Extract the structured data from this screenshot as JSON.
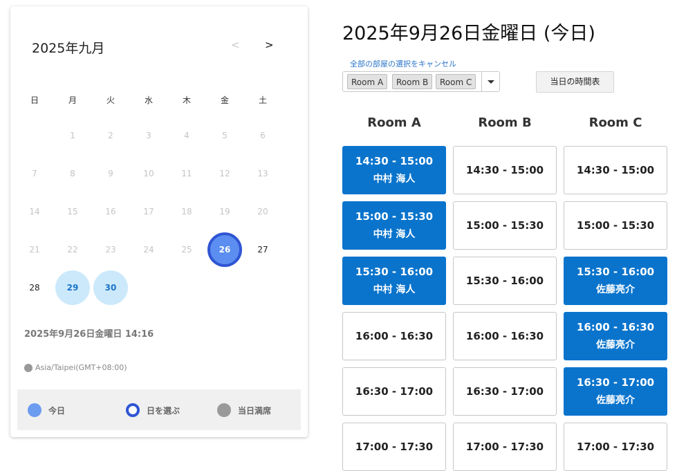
{
  "calendar": {
    "month_title": "2025年九月",
    "prev": "<",
    "next": ">",
    "weekdays": [
      "日",
      "月",
      "火",
      "水",
      "木",
      "金",
      "土"
    ],
    "days": [
      {
        "d": "1",
        "state": "muted"
      },
      {
        "d": "2",
        "state": "muted"
      },
      {
        "d": "3",
        "state": "muted"
      },
      {
        "d": "4",
        "state": "muted"
      },
      {
        "d": "5",
        "state": "muted"
      },
      {
        "d": "6",
        "state": "muted"
      },
      {
        "d": "7",
        "state": "muted"
      },
      {
        "d": "8",
        "state": "muted"
      },
      {
        "d": "9",
        "state": "muted"
      },
      {
        "d": "10",
        "state": "muted"
      },
      {
        "d": "11",
        "state": "muted"
      },
      {
        "d": "12",
        "state": "muted"
      },
      {
        "d": "13",
        "state": "muted"
      },
      {
        "d": "14",
        "state": "muted"
      },
      {
        "d": "15",
        "state": "muted"
      },
      {
        "d": "16",
        "state": "muted"
      },
      {
        "d": "17",
        "state": "muted"
      },
      {
        "d": "18",
        "state": "muted"
      },
      {
        "d": "19",
        "state": "muted"
      },
      {
        "d": "20",
        "state": "muted"
      },
      {
        "d": "21",
        "state": "muted"
      },
      {
        "d": "22",
        "state": "muted"
      },
      {
        "d": "23",
        "state": "muted"
      },
      {
        "d": "24",
        "state": "muted"
      },
      {
        "d": "25",
        "state": "muted"
      },
      {
        "d": "26",
        "state": "today"
      },
      {
        "d": "27",
        "state": "avail"
      },
      {
        "d": "28",
        "state": "avail"
      },
      {
        "d": "29",
        "state": "pick"
      },
      {
        "d": "30",
        "state": "pick"
      }
    ],
    "first_weekday": 1,
    "current_datetime": "2025年9月26日金曜日 14:16",
    "timezone": "Asia/Taipei(GMT+08:00)",
    "legend": [
      {
        "label": "今日",
        "color": "#6b9cf0"
      },
      {
        "label": "日を選ぶ",
        "color": "#2f55d4"
      },
      {
        "label": "当日満席",
        "color": "#999999"
      }
    ]
  },
  "schedule": {
    "title": "2025年9月26日金曜日 (今日)",
    "cancel_all": "全部の部屋の選択をキャンセル",
    "selected_rooms": [
      "Room A",
      "Room B",
      "Room C"
    ],
    "today_button": "当日の時間表",
    "rooms": [
      {
        "name": "Room A",
        "slots": [
          {
            "time": "14:30 - 15:00",
            "who": "中村 海人"
          },
          {
            "time": "15:00 - 15:30",
            "who": "中村 海人"
          },
          {
            "time": "15:30 - 16:00",
            "who": "中村 海人"
          },
          {
            "time": "16:00 - 16:30",
            "who": ""
          },
          {
            "time": "16:30 - 17:00",
            "who": ""
          },
          {
            "time": "17:00 - 17:30",
            "who": ""
          }
        ]
      },
      {
        "name": "Room B",
        "slots": [
          {
            "time": "14:30 - 15:00",
            "who": ""
          },
          {
            "time": "15:00 - 15:30",
            "who": ""
          },
          {
            "time": "15:30 - 16:00",
            "who": ""
          },
          {
            "time": "16:00 - 16:30",
            "who": ""
          },
          {
            "time": "16:30 - 17:00",
            "who": ""
          },
          {
            "time": "17:00 - 17:30",
            "who": ""
          }
        ]
      },
      {
        "name": "Room C",
        "slots": [
          {
            "time": "14:30 - 15:00",
            "who": ""
          },
          {
            "time": "15:00 - 15:30",
            "who": ""
          },
          {
            "time": "15:30 - 16:00",
            "who": "佐藤亮介"
          },
          {
            "time": "16:00 - 16:30",
            "who": "佐藤亮介"
          },
          {
            "time": "16:30 - 17:00",
            "who": "佐藤亮介"
          },
          {
            "time": "17:00 - 17:30",
            "who": ""
          }
        ]
      }
    ]
  }
}
